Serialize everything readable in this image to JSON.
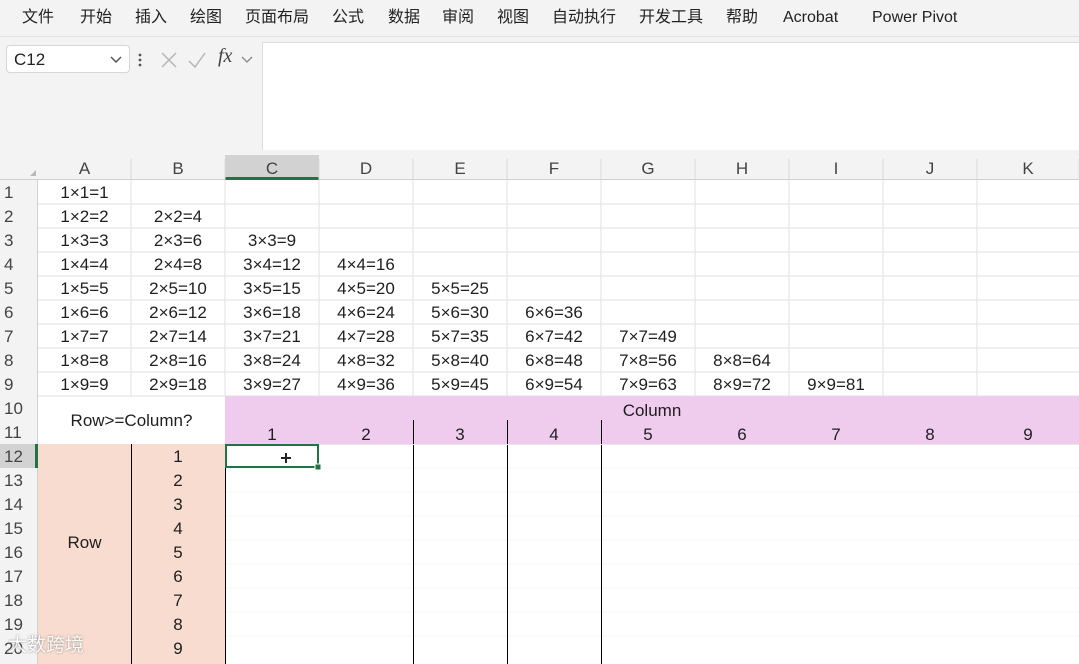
{
  "menu": [
    "文件",
    "开始",
    "插入",
    "绘图",
    "页面布局",
    "公式",
    "数据",
    "审阅",
    "视图",
    "自动执行",
    "开发工具",
    "帮助",
    "Acrobat",
    "Power Pivot"
  ],
  "formula_bar": {
    "name_box": "C12",
    "fx_label": "fx",
    "formula": ""
  },
  "column_headers": [
    "A",
    "B",
    "C",
    "D",
    "E",
    "F",
    "G",
    "H",
    "I",
    "J",
    "K"
  ],
  "row_headers": [
    "1",
    "2",
    "3",
    "4",
    "5",
    "6",
    "7",
    "8",
    "9",
    "10",
    "11",
    "12",
    "13",
    "14",
    "15",
    "16",
    "17",
    "18",
    "19",
    "20"
  ],
  "selected_cell": "C12",
  "multiplication_table": [
    [
      "1×1=1"
    ],
    [
      "1×2=2",
      "2×2=4"
    ],
    [
      "1×3=3",
      "2×3=6",
      "3×3=9"
    ],
    [
      "1×4=4",
      "2×4=8",
      "3×4=12",
      "4×4=16"
    ],
    [
      "1×5=5",
      "2×5=10",
      "3×5=15",
      "4×5=20",
      "5×5=25"
    ],
    [
      "1×6=6",
      "2×6=12",
      "3×6=18",
      "4×6=24",
      "5×6=30",
      "6×6=36"
    ],
    [
      "1×7=7",
      "2×7=14",
      "3×7=21",
      "4×7=28",
      "5×7=35",
      "6×7=42",
      "7×7=49"
    ],
    [
      "1×8=8",
      "2×8=16",
      "3×8=24",
      "4×8=32",
      "5×8=40",
      "6×8=48",
      "7×8=56",
      "8×8=64"
    ],
    [
      "1×9=9",
      "2×9=18",
      "3×9=27",
      "4×9=36",
      "5×9=45",
      "6×9=54",
      "7×9=63",
      "8×9=72",
      "9×9=81"
    ]
  ],
  "lookup_table": {
    "question": "Row>=Column?",
    "column_title": "Column",
    "column_numbers": [
      "1",
      "2",
      "3",
      "4",
      "5",
      "6",
      "7",
      "8",
      "9"
    ],
    "row_title": "Row",
    "row_numbers": [
      "1",
      "2",
      "3",
      "4",
      "5",
      "6",
      "7",
      "8",
      "9"
    ]
  },
  "colors": {
    "column_header_fill": "#efcbed",
    "row_header_fill": "#f8dccf",
    "selection": "#217346"
  },
  "watermark": "大数跨境"
}
